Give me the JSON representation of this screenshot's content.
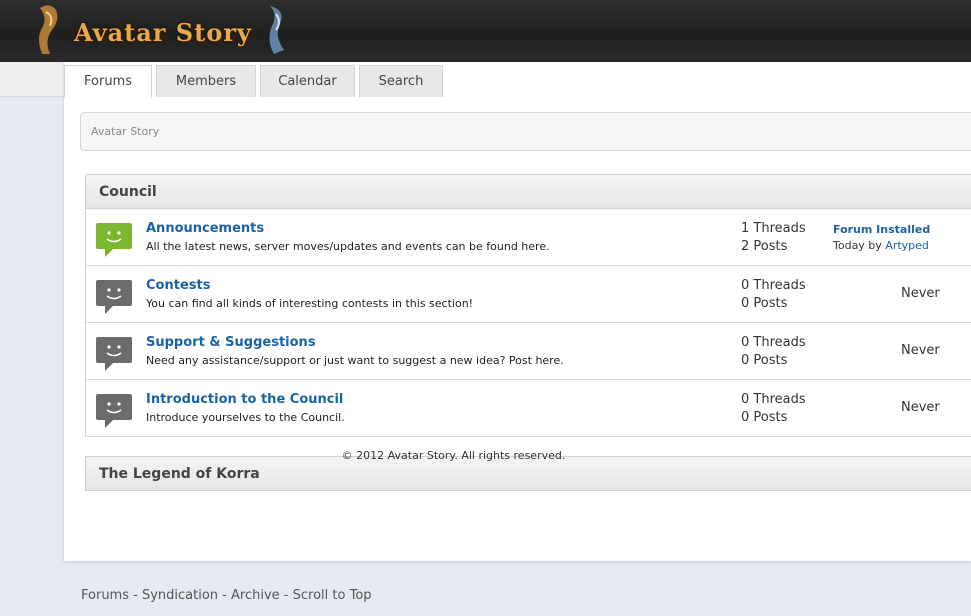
{
  "header": {
    "logo_text": "Avatar Story"
  },
  "tabs": [
    {
      "label": "Forums"
    },
    {
      "label": "Members"
    },
    {
      "label": "Calendar"
    },
    {
      "label": "Search"
    }
  ],
  "breadcrumb": "Avatar Story",
  "categories": [
    {
      "title": "Council"
    },
    {
      "title": "The Legend of Korra"
    }
  ],
  "forums": [
    {
      "title": "Announcements",
      "description": "All the latest news, server moves/updates and events can be found here.",
      "threads": "1 Threads",
      "posts": "2 Posts",
      "last_post_title": "Forum Installed",
      "last_post_prefix": "Today by ",
      "last_post_user": "Artyped",
      "icon_color": "#7cb82f"
    },
    {
      "title": "Contests",
      "description": "You can find all kinds of interesting contests in this section!",
      "threads": "0 Threads",
      "posts": "0 Posts",
      "last_post": "Never",
      "icon_color": "#6b6b6b"
    },
    {
      "title": "Support & Suggestions",
      "description": "Need any assistance/support or just want to suggest a new idea? Post here.",
      "threads": "0 Threads",
      "posts": "0 Posts",
      "last_post": "Never",
      "icon_color": "#6b6b6b"
    },
    {
      "title": "Introduction to the Council",
      "description": "Introduce yourselves to the Council.",
      "threads": "0 Threads",
      "posts": "0 Posts",
      "last_post": "Never",
      "icon_color": "#6b6b6b"
    }
  ],
  "footer": {
    "copyright": "© 2012 Avatar Story. All rights reserved."
  },
  "bottom_links": {
    "forums": "Forums",
    "syndication": "Syndication",
    "archive": "Archive",
    "scroll_top": "Scroll to Top",
    "separator": " - "
  }
}
